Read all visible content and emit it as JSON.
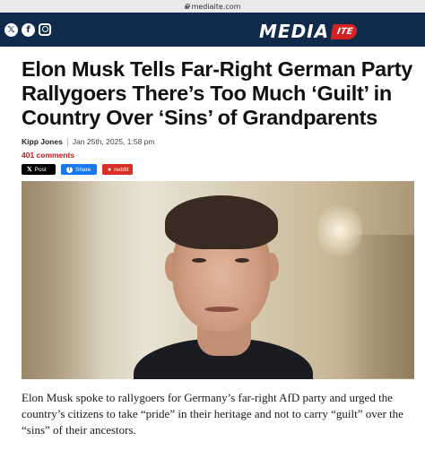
{
  "browser": {
    "url": "mediaite.com"
  },
  "header": {
    "logo_main": "MEDIA",
    "logo_badge": "ITE",
    "social_icons": [
      "x-icon",
      "facebook-icon",
      "instagram-icon"
    ]
  },
  "article": {
    "headline_lines": [
      "Elon Musk Tells Far-Right German Party",
      "Rallygoers There’s Too Much ‘Guilt’ in",
      "Country Over ‘Sins’ of Grandparents"
    ],
    "author": "Kipp Jones",
    "date": "Jan 25th, 2025, 1:58 pm",
    "comments": "401 comments",
    "share": {
      "x": "Post",
      "facebook": "Share",
      "reddit": "reddit"
    },
    "lede_lines": [
      "Elon Musk spoke to rallygoers for Germany’s far-right AfD party and urged the",
      "country’s citizens to take “pride” in their heritage and not to carry “guilt” over the",
      "“sins” of their ancestors."
    ]
  },
  "colors": {
    "header_bg": "#0f2a4a",
    "accent_red": "#c4161c",
    "facebook_blue": "#1877f2"
  }
}
